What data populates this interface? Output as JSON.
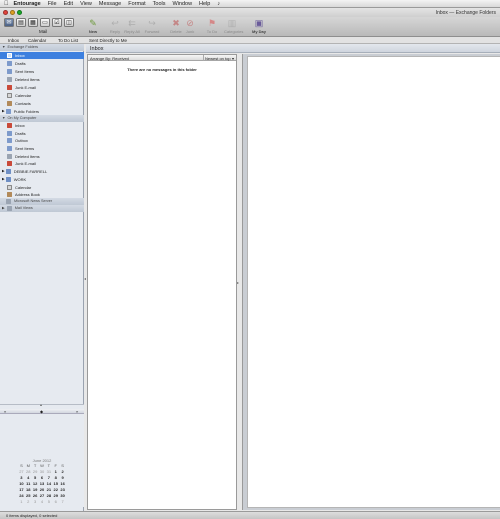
{
  "menubar": {
    "apple": "",
    "items": [
      "Entourage",
      "File",
      "Edit",
      "View",
      "Message",
      "Format",
      "Tools",
      "Window",
      "Help",
      "♪"
    ]
  },
  "window": {
    "title": "Inbox — Exchange Folders"
  },
  "toolbar": {
    "view_label": "Mail",
    "buttons": [
      {
        "label": "New",
        "icon": "new-message-icon",
        "enabled": true
      },
      {
        "label": "Reply",
        "icon": "reply-icon",
        "enabled": false
      },
      {
        "label": "Reply All",
        "icon": "reply-all-icon",
        "enabled": false
      },
      {
        "label": "Forward",
        "icon": "forward-icon",
        "enabled": false
      },
      {
        "label": "Delete",
        "icon": "delete-icon",
        "enabled": false
      },
      {
        "label": "Junk",
        "icon": "junk-icon",
        "enabled": false
      },
      {
        "label": "To Do",
        "icon": "todo-flag-icon",
        "enabled": false
      },
      {
        "label": "Categories",
        "icon": "categories-icon",
        "enabled": false
      },
      {
        "label": "My Day",
        "icon": "my-day-icon",
        "enabled": true
      }
    ]
  },
  "nav_tabs": [
    "Inbox",
    "Calendar",
    "To Do List"
  ],
  "sent_directly": "Sent Directly to Me",
  "sidebar": {
    "sections": [
      {
        "title": "Exchange Folders",
        "items": [
          "Inbox",
          "Drafts",
          "Sent Items",
          "Deleted Items",
          "Junk E-mail",
          "Calendar",
          "Contacts",
          "Public Folders"
        ]
      },
      {
        "title": "On My Computer",
        "items": [
          "Inbox",
          "Drafts",
          "Outbox",
          "Sent Items",
          "Deleted Items",
          "Junk E-mail",
          "DEBBIE.FARRELL",
          "WORK",
          "Calendar",
          "Address Book"
        ]
      },
      {
        "title": "Microsoft News Server",
        "items": []
      },
      {
        "title": "Mail Views",
        "items": []
      }
    ],
    "selected": "Inbox"
  },
  "calendar": {
    "month": "June 2012",
    "day_headers": [
      "S",
      "M",
      "T",
      "W",
      "T",
      "F",
      "S"
    ],
    "weeks": [
      [
        "27",
        "28",
        "29",
        "30",
        "31",
        "1",
        "2"
      ],
      [
        "3",
        "4",
        "5",
        "6",
        "7",
        "8",
        "9"
      ],
      [
        "10",
        "11",
        "12",
        "13",
        "14",
        "15",
        "16"
      ],
      [
        "17",
        "18",
        "19",
        "20",
        "21",
        "22",
        "23"
      ],
      [
        "24",
        "25",
        "26",
        "27",
        "28",
        "29",
        "30"
      ],
      [
        "1",
        "2",
        "3",
        "4",
        "5",
        "6",
        "7"
      ]
    ],
    "nav_prev": "«",
    "nav_today": "◆",
    "nav_next": "»"
  },
  "inbox_header": "Inbox",
  "message_list": {
    "arrange_by": "Arrange By: Received",
    "sort": "Newest on top",
    "empty_text": "There are no messages in this folder"
  },
  "status": "0 items displayed, 0 selected",
  "colors": {
    "selection": "#3d80df",
    "sidebar_bg": "#e6eaf0",
    "folder": "#6f8fc4"
  }
}
